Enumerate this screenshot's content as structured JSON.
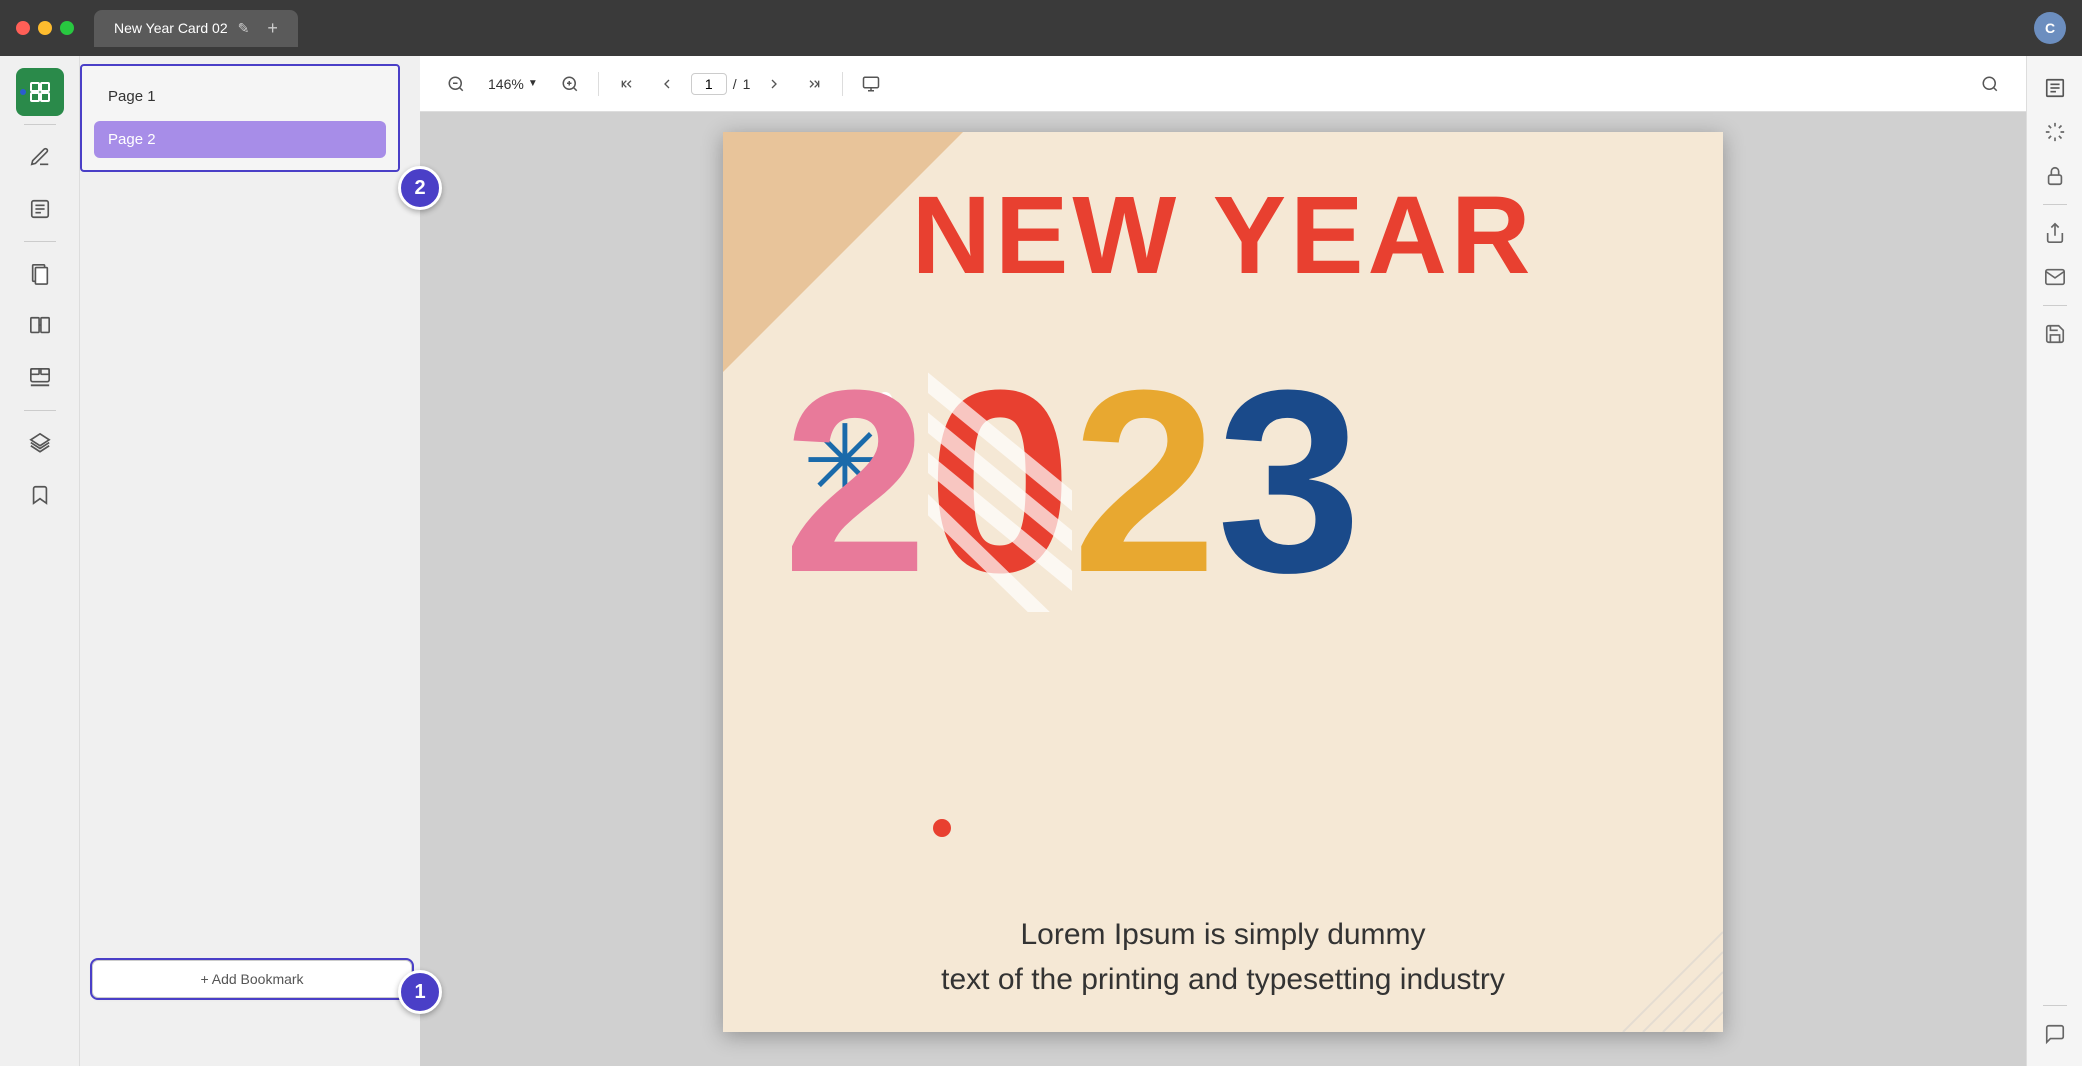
{
  "titleBar": {
    "title": "New Year Card 02",
    "editIcon": "✎",
    "addTabIcon": "+",
    "userInitial": "C"
  },
  "sidebar": {
    "items": [
      {
        "name": "thumbnails",
        "icon": "⊞",
        "active": true
      },
      {
        "name": "divider1"
      },
      {
        "name": "annotate",
        "icon": "✏"
      },
      {
        "name": "forms",
        "icon": "📋"
      },
      {
        "name": "divider2"
      },
      {
        "name": "pages",
        "icon": "📄"
      },
      {
        "name": "compare",
        "icon": "⧉"
      },
      {
        "name": "stamps",
        "icon": "🔒"
      },
      {
        "name": "divider3"
      },
      {
        "name": "layers",
        "icon": "◱"
      },
      {
        "name": "bookmarks",
        "icon": "🔖"
      }
    ]
  },
  "pagePanel": {
    "pages": [
      {
        "label": "Page 1",
        "active": false
      },
      {
        "label": "Page 2",
        "active": true
      }
    ],
    "addBookmark": "+ Add Bookmark",
    "stepBadge1": "1",
    "stepBadge2": "2"
  },
  "toolbar": {
    "zoomOut": "−",
    "zoomLevel": "146%",
    "zoomIn": "+",
    "firstPage": "⇈",
    "prevPage": "⌃",
    "currentPage": "1",
    "totalPages": "1",
    "nextPage": "⌄",
    "lastPage": "⇊",
    "present": "▣",
    "search": "🔍"
  },
  "document": {
    "title": "NEW YEAR",
    "year": "2023",
    "loremText1": "Lorem Ipsum is simply dummy",
    "loremText2": "text of the printing and typesetting industry"
  },
  "rightSidebar": {
    "items": [
      {
        "name": "ocr",
        "icon": "OCR"
      },
      {
        "name": "convert",
        "icon": "⟳"
      },
      {
        "name": "protect",
        "icon": "🔒"
      },
      {
        "name": "divider1"
      },
      {
        "name": "share",
        "icon": "↑"
      },
      {
        "name": "email",
        "icon": "✉"
      },
      {
        "name": "divider2"
      },
      {
        "name": "save",
        "icon": "💾"
      },
      {
        "name": "divider3"
      },
      {
        "name": "comment",
        "icon": "💬"
      }
    ]
  }
}
